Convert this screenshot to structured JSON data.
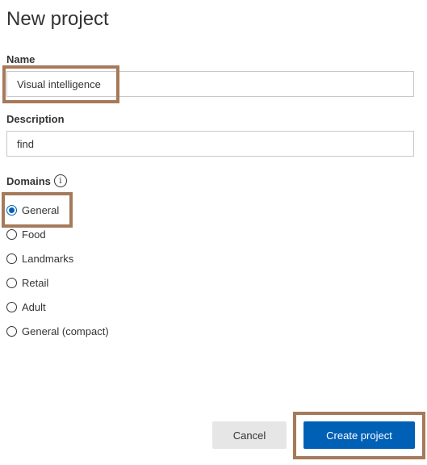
{
  "dialog": {
    "title": "New project"
  },
  "name_field": {
    "label": "Name",
    "value": "Visual intelligence"
  },
  "description_field": {
    "label": "Description",
    "value": "find"
  },
  "domains": {
    "label": "Domains",
    "info_icon": "info-icon",
    "selected": "General",
    "options": [
      {
        "label": "General"
      },
      {
        "label": "Food"
      },
      {
        "label": "Landmarks"
      },
      {
        "label": "Retail"
      },
      {
        "label": "Adult"
      },
      {
        "label": "General (compact)"
      }
    ]
  },
  "buttons": {
    "cancel_label": "Cancel",
    "create_label": "Create project"
  },
  "colors": {
    "accent": "#0060b6",
    "highlight_box": "#a57a5a",
    "cancel_bg": "#e6e6e6"
  }
}
